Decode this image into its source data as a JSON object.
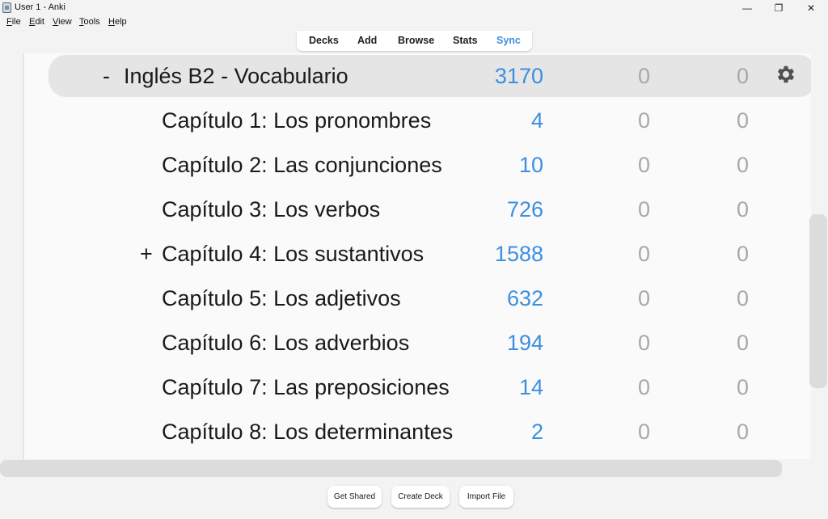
{
  "window": {
    "title": "User 1 - Anki",
    "min_glyph": "—",
    "max_glyph": "❐",
    "close_glyph": "✕"
  },
  "menu": [
    {
      "label": "File",
      "ul": "F",
      "rest": "ile"
    },
    {
      "label": "Edit",
      "ul": "E",
      "rest": "dit"
    },
    {
      "label": "View",
      "ul": "V",
      "rest": "iew"
    },
    {
      "label": "Tools",
      "ul": "T",
      "rest": "ools"
    },
    {
      "label": "Help",
      "ul": "H",
      "rest": "elp"
    }
  ],
  "toolbar": {
    "decks": "Decks",
    "add": "Add",
    "browse": "Browse",
    "stats": "Stats",
    "sync": "Sync"
  },
  "decks": [
    {
      "expander": "-",
      "name": "Inglés B2 - Vocabulario",
      "new": "3170",
      "learn": "0",
      "due": "0",
      "current": true
    },
    {
      "expander": "",
      "name": "Capítulo 1: Los pronombres",
      "new": "4",
      "learn": "0",
      "due": "0"
    },
    {
      "expander": "",
      "name": "Capítulo 2: Las conjunciones",
      "new": "10",
      "learn": "0",
      "due": "0"
    },
    {
      "expander": "",
      "name": "Capítulo 3: Los verbos",
      "new": "726",
      "learn": "0",
      "due": "0"
    },
    {
      "expander": "+",
      "name": "Capítulo 4: Los sustantivos",
      "new": "1588",
      "learn": "0",
      "due": "0"
    },
    {
      "expander": "",
      "name": "Capítulo 5: Los adjetivos",
      "new": "632",
      "learn": "0",
      "due": "0"
    },
    {
      "expander": "",
      "name": "Capítulo 6: Los adverbios",
      "new": "194",
      "learn": "0",
      "due": "0"
    },
    {
      "expander": "",
      "name": "Capítulo 7: Las preposiciones",
      "new": "14",
      "learn": "0",
      "due": "0"
    },
    {
      "expander": "",
      "name": "Capítulo 8: Los determinantes",
      "new": "2",
      "learn": "0",
      "due": "0"
    }
  ],
  "bottom": {
    "get_shared": "Get Shared",
    "create_deck": "Create Deck",
    "import_file": "Import File"
  },
  "colors": {
    "accent": "#3d8fe0",
    "muted": "#a8a8a8",
    "current_row": "#e5e5e5"
  },
  "icons": {
    "gear": "gear-icon",
    "app": "anki-app-icon"
  }
}
